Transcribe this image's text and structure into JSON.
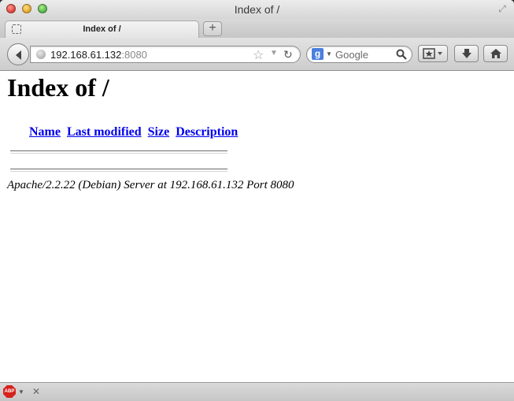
{
  "window": {
    "title": "Index of /"
  },
  "tabs": [
    {
      "label": "Index of /"
    }
  ],
  "new_tab": "+",
  "navbar": {
    "url_host": "192.168.61.132",
    "url_port": ":8080",
    "search_placeholder": "Google",
    "search_engine_letter": "g"
  },
  "page": {
    "heading": "Index of /",
    "columns": [
      "Name",
      "Last modified",
      "Size",
      "Description"
    ],
    "address": "Apache/2.2.22 (Debian) Server at 192.168.61.132 Port 8080"
  },
  "addonbar": {
    "abp_label": "ABP",
    "close": "✕"
  },
  "icons": [
    "close-window-icon",
    "minimize-window-icon",
    "zoom-window-icon",
    "fullscreen-icon",
    "favicon-placeholder-icon",
    "back-arrow-icon",
    "globe-icon",
    "bookmark-star-icon",
    "history-dropdown-icon",
    "reload-icon",
    "google-icon",
    "search-magnifier-icon",
    "bookmarks-icon",
    "download-icon",
    "home-icon",
    "adblock-plus-icon"
  ]
}
